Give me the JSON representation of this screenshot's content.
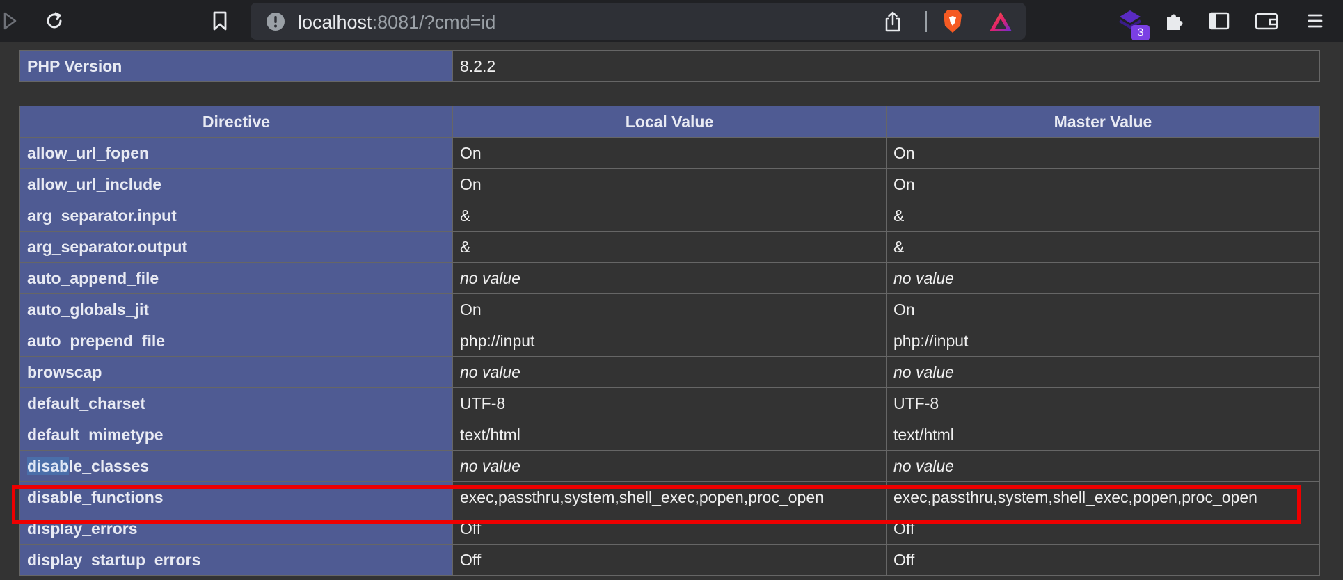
{
  "browser": {
    "url_host": "localhost",
    "url_rest": ":8081/?cmd=id",
    "extension_badge_count": "3",
    "accent_colors": {
      "brave": "#f55a23",
      "extension": "#7b3fe4",
      "highlight": "#ee0000"
    }
  },
  "version_table": {
    "label": "PHP Version",
    "value": "8.2.2"
  },
  "directives_table": {
    "headers": [
      "Directive",
      "Local Value",
      "Master Value"
    ],
    "rows": [
      {
        "directive": "allow_url_fopen",
        "local": "On",
        "master": "On"
      },
      {
        "directive": "allow_url_include",
        "local": "On",
        "master": "On"
      },
      {
        "directive": "arg_separator.input",
        "local": "&",
        "master": "&"
      },
      {
        "directive": "arg_separator.output",
        "local": "&",
        "master": "&"
      },
      {
        "directive": "auto_append_file",
        "local": "no value",
        "master": "no value"
      },
      {
        "directive": "auto_globals_jit",
        "local": "On",
        "master": "On"
      },
      {
        "directive": "auto_prepend_file",
        "local": "php://input",
        "master": "php://input"
      },
      {
        "directive": "browscap",
        "local": "no value",
        "master": "no value"
      },
      {
        "directive": "default_charset",
        "local": "UTF-8",
        "master": "UTF-8"
      },
      {
        "directive": "default_mimetype",
        "local": "text/html",
        "master": "text/html"
      },
      {
        "directive_selected": "disab",
        "directive_rest": "le_classes",
        "local": "no value",
        "master": "no value"
      },
      {
        "directive": "disable_functions",
        "local": "exec,passthru,system,shell_exec,popen,proc_open",
        "master": "exec,passthru,system,shell_exec,popen,proc_open"
      },
      {
        "directive": "display_errors",
        "local": "Off",
        "master": "Off"
      },
      {
        "directive": "display_startup_errors",
        "local": "Off",
        "master": "Off"
      }
    ]
  }
}
